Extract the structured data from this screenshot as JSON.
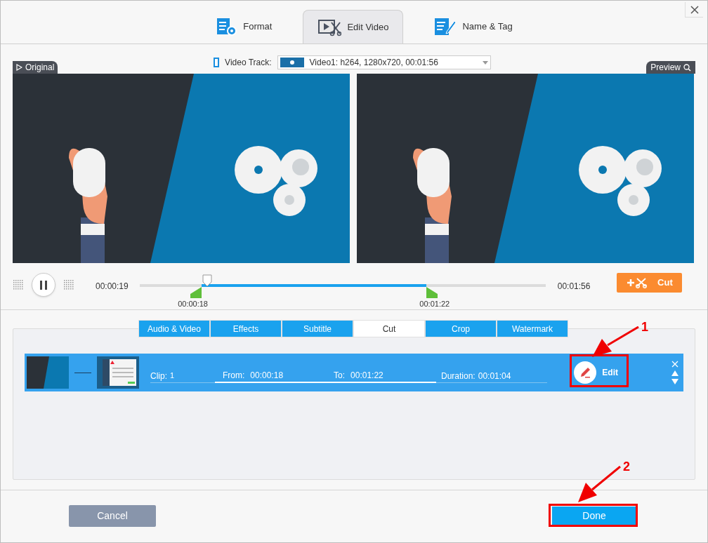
{
  "top_tabs": [
    {
      "label": "Format",
      "kind": "format",
      "selected": false
    },
    {
      "label": "Edit Video",
      "kind": "edit",
      "selected": true
    },
    {
      "label": "Name & Tag",
      "kind": "tag",
      "selected": false
    }
  ],
  "video_track": {
    "label": "Video Track:",
    "value": "Video1: h264, 1280x720, 00:01:56"
  },
  "panels": {
    "original": "Original",
    "preview": "Preview"
  },
  "timeline": {
    "current": "00:00:19",
    "total": "00:01:56",
    "scrubber": {
      "level": 0.166
    },
    "range_start": {
      "time": "00:00:18",
      "level": 0.152
    },
    "range_end": {
      "time": "00:01:22",
      "level": 0.706
    },
    "cut_button": "Cut"
  },
  "edit_tabs": [
    {
      "label": "Audio & Video",
      "selected": false
    },
    {
      "label": "Effects",
      "selected": false
    },
    {
      "label": "Subtitle",
      "selected": false
    },
    {
      "label": "Cut",
      "selected": true
    },
    {
      "label": "Crop",
      "selected": false
    },
    {
      "label": "Watermark",
      "selected": false
    }
  ],
  "clips": [
    {
      "clip_label": "Clip:",
      "clip_number": "1",
      "from_label": "From:",
      "from": "00:00:18",
      "to_label": "To:",
      "to": "00:01:22",
      "duration_label": "Duration:",
      "duration": "00:01:04",
      "edit_button": "Edit"
    }
  ],
  "annotations": [
    "1",
    "2"
  ],
  "buttons": {
    "cancel": "Cancel",
    "done": "Done"
  }
}
